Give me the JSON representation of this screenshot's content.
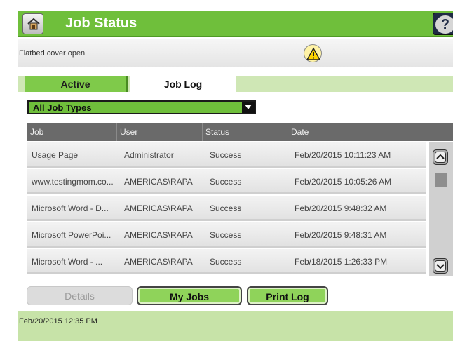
{
  "header": {
    "title": "Job Status",
    "home_icon": "home-icon",
    "help_icon": "help-icon",
    "help_glyph": "?"
  },
  "status": {
    "message": "Flatbed cover open",
    "warning_icon": "warning-icon"
  },
  "tabs": [
    {
      "label": "Active",
      "selected": true
    },
    {
      "label": "Job Log",
      "selected": false
    }
  ],
  "filter": {
    "selected": "All Job Types"
  },
  "table": {
    "columns": [
      "Job",
      "User",
      "Status",
      "Date"
    ],
    "rows": [
      {
        "job": "Usage Page",
        "user": "Administrator",
        "status": "Success",
        "date": "Feb/20/2015 10:11:23 AM"
      },
      {
        "job": "www.testingmom.co...",
        "user": "AMERICAS\\RAPA",
        "status": "Success",
        "date": "Feb/20/2015 10:05:26 AM"
      },
      {
        "job": "Microsoft Word - D...",
        "user": "AMERICAS\\RAPA",
        "status": "Success",
        "date": "Feb/20/2015 9:48:32 AM"
      },
      {
        "job": "Microsoft PowerPoi...",
        "user": "AMERICAS\\RAPA",
        "status": "Success",
        "date": "Feb/20/2015 9:48:31 AM"
      },
      {
        "job": "Microsoft Word - ...",
        "user": "AMERICAS\\RAPA",
        "status": "Success",
        "date": "Feb/18/2015 1:26:33 PM"
      }
    ]
  },
  "buttons": {
    "details": "Details",
    "my_jobs": "My Jobs",
    "print_log": "Print Log"
  },
  "footer": {
    "datetime": "Feb/20/2015 12:35 PM"
  },
  "colors": {
    "accent": "#6fbf3b",
    "header_bg": "#6fbf3b",
    "table_header": "#6a6a6a"
  }
}
